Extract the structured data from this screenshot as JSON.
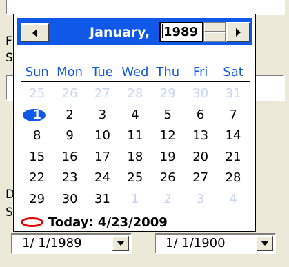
{
  "background": {
    "letters": [
      "F",
      "S",
      "D",
      "S"
    ]
  },
  "calendar": {
    "month_label": "January,",
    "year_value": "1989",
    "weekdays": [
      "Sun",
      "Mon",
      "Tue",
      "Wed",
      "Thu",
      "Fri",
      "Sat"
    ],
    "weeks": [
      [
        {
          "d": "25",
          "o": true
        },
        {
          "d": "26",
          "o": true
        },
        {
          "d": "27",
          "o": true
        },
        {
          "d": "28",
          "o": true
        },
        {
          "d": "29",
          "o": true
        },
        {
          "d": "30",
          "o": true
        },
        {
          "d": "31",
          "o": true
        }
      ],
      [
        {
          "d": "1",
          "sel": true
        },
        {
          "d": "2"
        },
        {
          "d": "3"
        },
        {
          "d": "4"
        },
        {
          "d": "5"
        },
        {
          "d": "6"
        },
        {
          "d": "7"
        }
      ],
      [
        {
          "d": "8"
        },
        {
          "d": "9"
        },
        {
          "d": "10"
        },
        {
          "d": "11"
        },
        {
          "d": "12"
        },
        {
          "d": "13"
        },
        {
          "d": "14"
        }
      ],
      [
        {
          "d": "15"
        },
        {
          "d": "16"
        },
        {
          "d": "17"
        },
        {
          "d": "18"
        },
        {
          "d": "19"
        },
        {
          "d": "20"
        },
        {
          "d": "21"
        }
      ],
      [
        {
          "d": "22"
        },
        {
          "d": "23"
        },
        {
          "d": "24"
        },
        {
          "d": "25"
        },
        {
          "d": "26"
        },
        {
          "d": "27"
        },
        {
          "d": "28"
        }
      ],
      [
        {
          "d": "29"
        },
        {
          "d": "30"
        },
        {
          "d": "31"
        },
        {
          "d": "1",
          "o": true
        },
        {
          "d": "2",
          "o": true
        },
        {
          "d": "3",
          "o": true
        },
        {
          "d": "4",
          "o": true
        }
      ]
    ],
    "today_label": "Today: 4/23/2009",
    "colors": {
      "header": "#1059e8",
      "weekday_text": "#1059e8",
      "selected": "#1059e8",
      "other_month": "#c8d4f0",
      "today_marker": "#e00000"
    }
  },
  "pickers": {
    "left_value": "1/ 1/1989",
    "right_value": "1/ 1/1900"
  }
}
